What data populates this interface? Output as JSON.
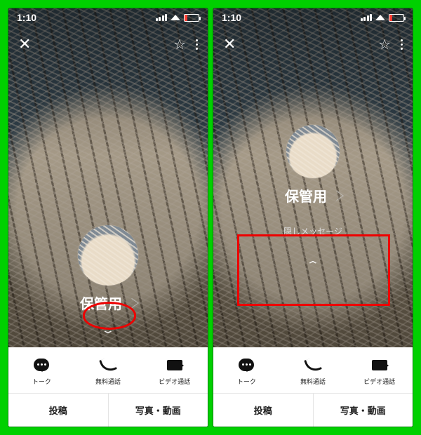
{
  "status": {
    "time": "1:10"
  },
  "profile": {
    "name": "保管用",
    "hidden_message_label": "隠しメッセージ"
  },
  "actions": {
    "talk": {
      "label": "トーク"
    },
    "call": {
      "label": "無料通話"
    },
    "video": {
      "label": "ビデオ通話"
    }
  },
  "tabs": {
    "posts": "投稿",
    "media": "写真・動画"
  }
}
